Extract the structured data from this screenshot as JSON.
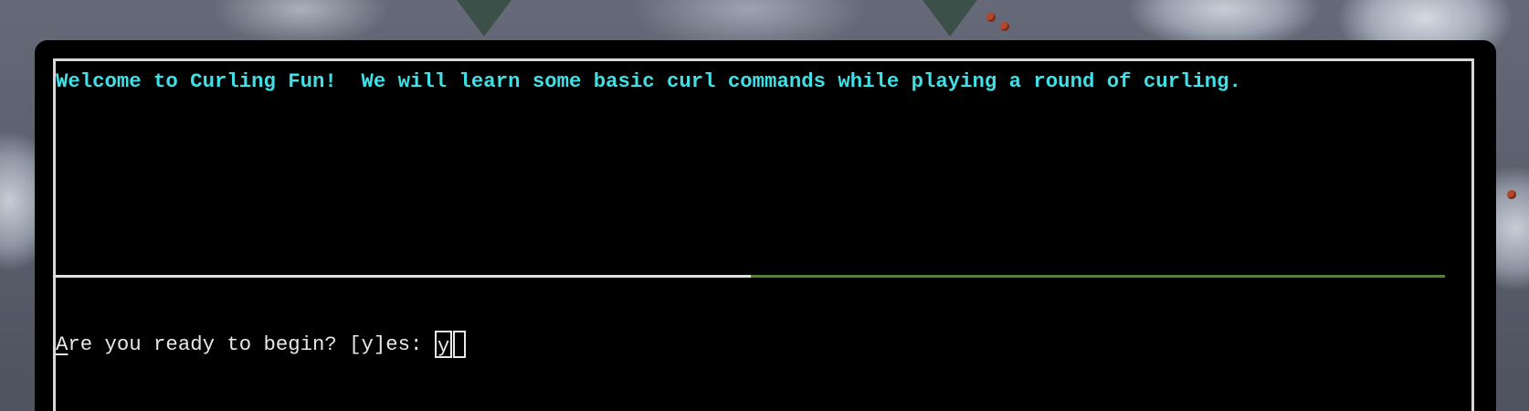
{
  "terminal": {
    "output_line": "Welcome to Curling Fun!  We will learn some basic curl commands while playing a round of curling.",
    "prompt": {
      "first_char": "A",
      "rest": "re you ready to begin? [y]es: ",
      "answer_value": "y"
    },
    "progress": {
      "fraction_complete": 0.5,
      "done_color": "#e0e0e0",
      "remaining_color": "#4e8a1e"
    },
    "colors": {
      "output_text": "#3fe0e6",
      "prompt_text": "#e8e8e8",
      "background": "#000000"
    }
  }
}
